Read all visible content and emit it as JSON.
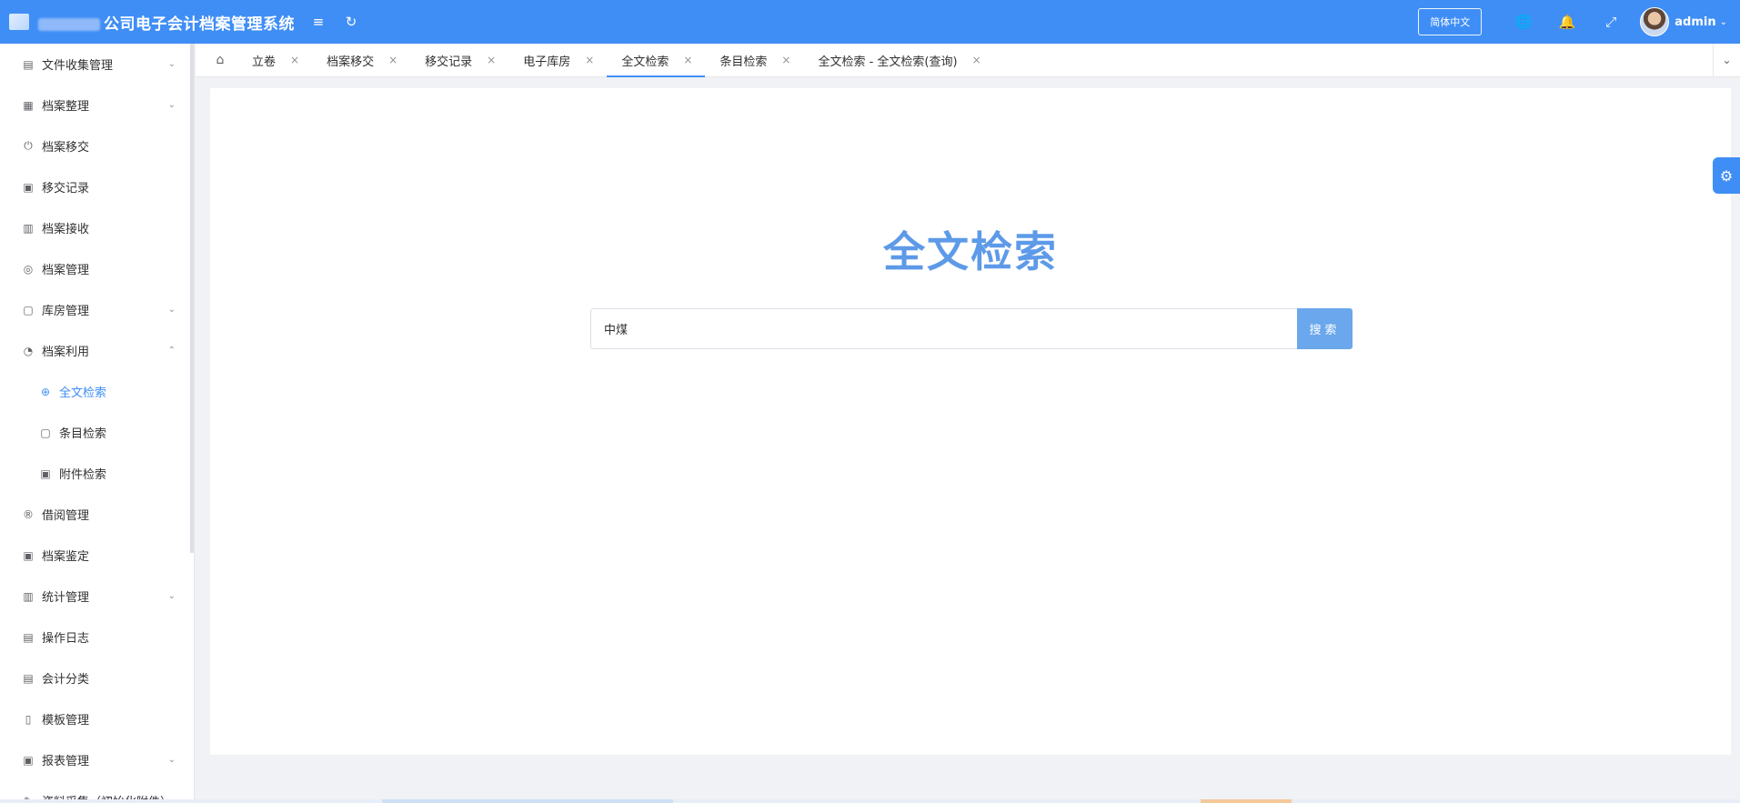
{
  "header": {
    "title": "公司电子会计档案管理系统",
    "lang_label": "简体中文",
    "user_name": "admin",
    "icons": {
      "menu_toggle": "≡",
      "refresh": "↻",
      "globe": "🌐",
      "bell": "🔔",
      "fullscreen": "⤢",
      "caret": "⌄"
    }
  },
  "sidebar": {
    "items": [
      {
        "label": "文件收集管理",
        "icon": "▤",
        "caret": "⌄"
      },
      {
        "label": "档案整理",
        "icon": "▦",
        "caret": "⌄"
      },
      {
        "label": "档案移交",
        "icon": "⏻",
        "caret": ""
      },
      {
        "label": "移交记录",
        "icon": "▣",
        "caret": ""
      },
      {
        "label": "档案接收",
        "icon": "▥",
        "caret": ""
      },
      {
        "label": "档案管理",
        "icon": "◎",
        "caret": ""
      },
      {
        "label": "库房管理",
        "icon": "▢",
        "caret": "⌄"
      },
      {
        "label": "档案利用",
        "icon": "◔",
        "caret": "⌃"
      },
      {
        "label": "全文检索",
        "icon": "⊕",
        "caret": ""
      },
      {
        "label": "条目检索",
        "icon": "▢",
        "caret": ""
      },
      {
        "label": "附件检索",
        "icon": "▣",
        "caret": ""
      },
      {
        "label": "借阅管理",
        "icon": "®",
        "caret": ""
      },
      {
        "label": "档案鉴定",
        "icon": "▣",
        "caret": ""
      },
      {
        "label": "统计管理",
        "icon": "▥",
        "caret": "⌄"
      },
      {
        "label": "操作日志",
        "icon": "▤",
        "caret": ""
      },
      {
        "label": "会计分类",
        "icon": "▤",
        "caret": ""
      },
      {
        "label": "模板管理",
        "icon": "▯",
        "caret": ""
      },
      {
        "label": "报表管理",
        "icon": "▣",
        "caret": "⌄"
      },
      {
        "label": "资料采集（初始化附件）",
        "icon": "✎",
        "caret": ""
      }
    ]
  },
  "tabs": {
    "home_icon": "⌂",
    "close_icon": "×",
    "more_icon": "⌄",
    "items": [
      {
        "label": "立卷"
      },
      {
        "label": "档案移交"
      },
      {
        "label": "移交记录"
      },
      {
        "label": "电子库房"
      },
      {
        "label": "全文检索"
      },
      {
        "label": "条目检索"
      },
      {
        "label": "全文检索 - 全文检索(查询)"
      }
    ]
  },
  "main": {
    "title": "全文检索",
    "search_value": "中煤",
    "search_button": "搜索"
  },
  "settings_icon": "⚙",
  "colors": {
    "primary": "#3f8ef5",
    "title": "#5d9ae8",
    "button": "#6aa7ec"
  }
}
